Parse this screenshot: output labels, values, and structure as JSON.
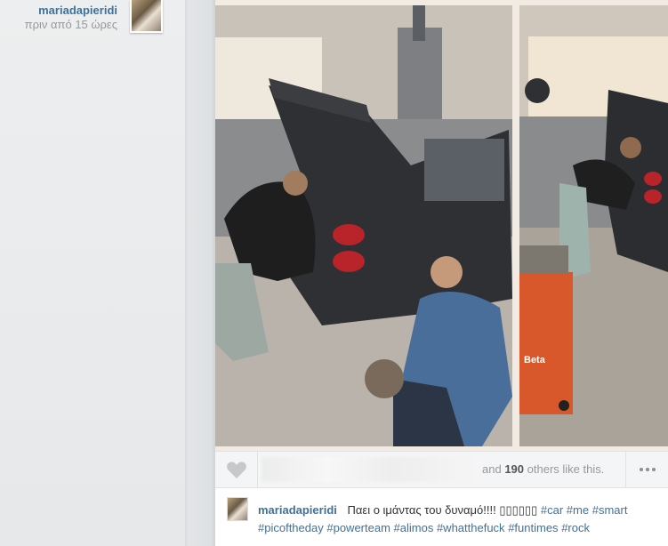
{
  "author": {
    "username": "mariadapieridi",
    "time": "πριν από 15 ώρες"
  },
  "likes": {
    "connector": "and",
    "count": "190",
    "suffix": "others like this."
  },
  "caption": {
    "username": "mariadapieridi",
    "text": "Παει ο ιμάντας του δυναμό!!!! ▯▯▯▯▯▯",
    "hashtags": [
      "#car",
      "#me",
      "#smart",
      "#picoftheday",
      "#powerteam",
      "#alimos",
      "#whatthefuck",
      "#funtimes",
      "#rock"
    ]
  },
  "icons": {
    "like": "heart-icon",
    "more": "ellipsis-icon"
  },
  "photo": {
    "panels": 2,
    "subject": "smart car in workshop",
    "badge_text": "Beta"
  },
  "colors": {
    "link": "#3f729b",
    "muted": "#999999",
    "text": "#333333",
    "background": "#e9eaeb"
  }
}
